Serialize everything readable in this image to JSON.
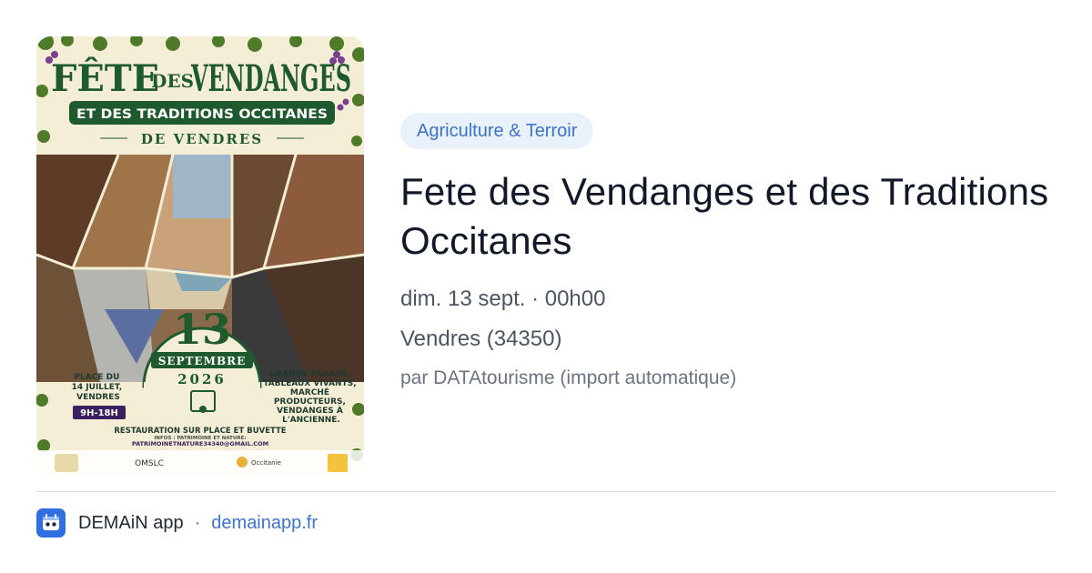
{
  "poster": {
    "title_line1_a": "FÊTE",
    "title_line1_b": "DES",
    "title_line1_c": "VENDANGES",
    "banner": "ET DES TRADITIONS OCCITANES",
    "subtitle": "DE VENDRES",
    "day": "13",
    "month": "SEPTEMBRE",
    "year": "2026",
    "location_lines": [
      "PLACE DU",
      "14 JUILLET,",
      "VENDRES"
    ],
    "hours": "9H-18H",
    "program_lines": [
      "GRANDE PARADE,",
      "TABLEAUX VIVANTS,",
      "MARCHÉ",
      "PRODUCTEURS,",
      "VENDANGES À",
      "L'ANCIENNE."
    ],
    "restauration": "RESTAURATION SUR PLACE ET BUVETTE",
    "infos": "INFOS : PATRIMOINE ET NATURE:",
    "email": "PATRIMOINETNATURE34340@GMAIL.COM",
    "logo_omslc": "OMSLC",
    "logo_occitanie": "Occitanie"
  },
  "category": "Agriculture & Terroir",
  "title": "Fete des Vendanges et des Traditions Occitanes",
  "datetime": "dim. 13 sept. · 00h00",
  "location": "Vendres (34350)",
  "source": "par DATAtourisme (import automatique)",
  "footer": {
    "app_name": "DEMAiN app",
    "separator": "·",
    "domain": "demainapp.fr"
  },
  "colors": {
    "tag_bg": "#e9f1fb",
    "tag_text": "#3d74c9",
    "link": "#3d74c9",
    "poster_green": "#1e5a2e",
    "poster_bg": "#f5f0dc"
  },
  "icons": {
    "app": "demain-app-icon"
  }
}
